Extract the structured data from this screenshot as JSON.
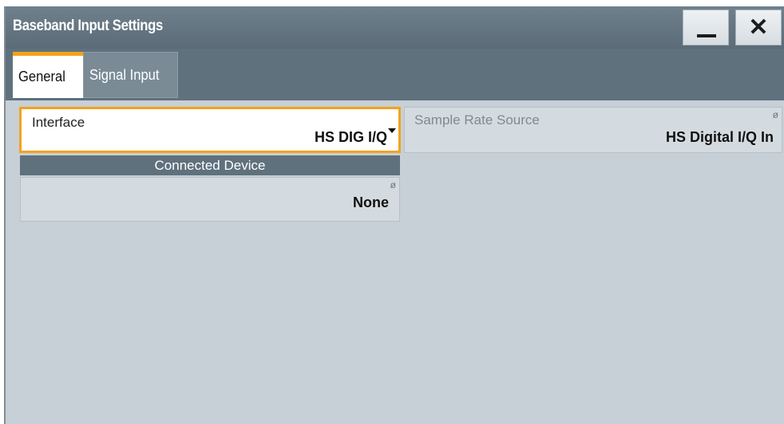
{
  "window": {
    "title": "Baseband Input Settings",
    "minimize_icon": "minimize-icon",
    "close_icon": "close-icon",
    "close_glyph": "✕"
  },
  "tabs": [
    {
      "label": "General",
      "active": true
    },
    {
      "label": "Signal Input",
      "active": false
    }
  ],
  "interface": {
    "label": "Interface",
    "value": "HS DIG I/Q"
  },
  "sample_rate_source": {
    "label": "Sample Rate Source",
    "value": "HS Digital I/Q In",
    "readonly_icon": "ø"
  },
  "connected_device": {
    "header": "Connected Device",
    "value": "None",
    "readonly_icon": "ø"
  },
  "colors": {
    "accent": "#f3a21b",
    "titlebar": "#5f717d",
    "panel": "#c6d0d6"
  }
}
